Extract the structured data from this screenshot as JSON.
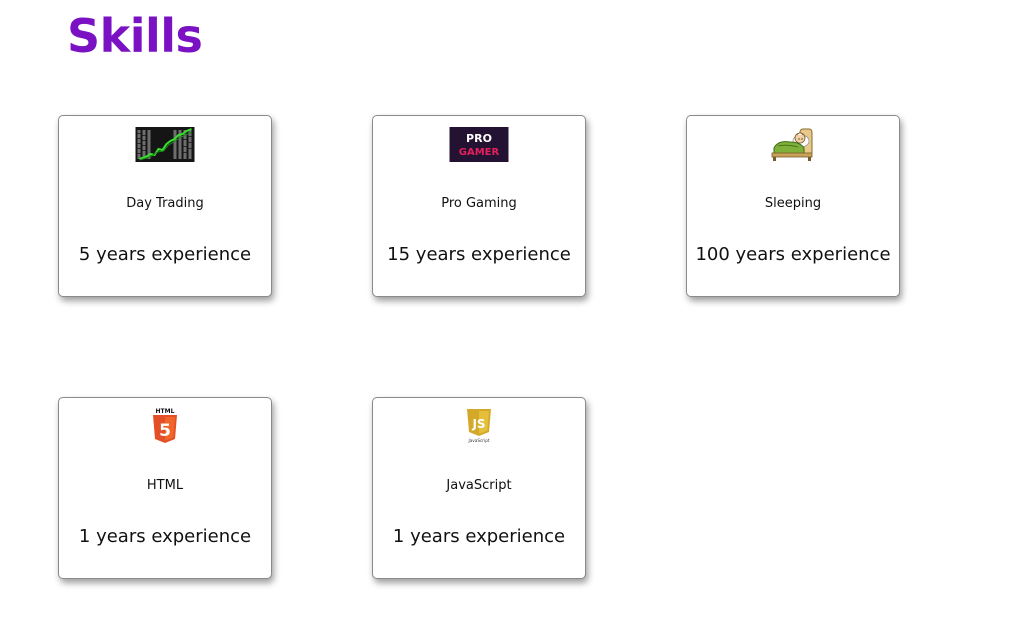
{
  "colors": {
    "accent": "#7a12c4",
    "card_border": "#8a8a8a"
  },
  "page": {
    "title": "Skills"
  },
  "skills": [
    {
      "name": "Day Trading",
      "experience": "5 years experience",
      "icon": "stock-chart-icon"
    },
    {
      "name": "Pro Gaming",
      "experience": "15 years experience",
      "icon": "pro-gamer-logo-icon",
      "icon_text_line1": "PRO",
      "icon_text_line2": "GAMER"
    },
    {
      "name": "Sleeping",
      "experience": "100 years experience",
      "icon": "sleeping-in-bed-icon"
    },
    {
      "name": "HTML",
      "experience": "1 years experience",
      "icon": "html5-logo-icon",
      "icon_label": "HTML",
      "icon_glyph": "5"
    },
    {
      "name": "JavaScript",
      "experience": "1 years experience",
      "icon": "javascript-logo-icon",
      "icon_glyph": "JS",
      "icon_caption": "JavaScript"
    }
  ]
}
